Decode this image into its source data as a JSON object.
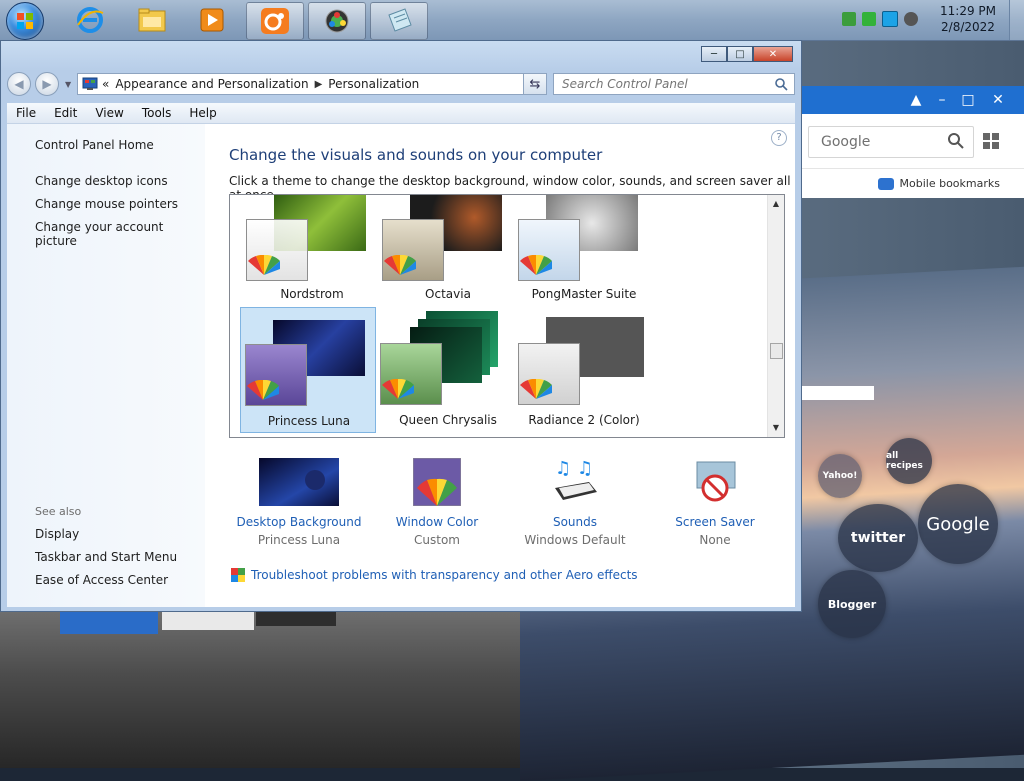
{
  "taskbar": {
    "clock_time": "11:29 PM",
    "clock_date": "2/8/2022",
    "pinned": [
      {
        "name": "internet-explorer-icon"
      },
      {
        "name": "file-explorer-icon"
      },
      {
        "name": "media-player-icon"
      },
      {
        "name": "uc-browser-icon"
      },
      {
        "name": "control-panel-icon"
      },
      {
        "name": "notepad-icon"
      }
    ]
  },
  "browser": {
    "search_text": "Google",
    "bookmarks_label": "Mobile bookmarks",
    "speed_dial": [
      "all recipes",
      "Yahoo!",
      "Google",
      "twitter",
      "Blogger"
    ]
  },
  "window": {
    "breadcrumb": [
      "Appearance and Personalization",
      "Personalization"
    ],
    "breadcrumb_prefix": "«",
    "search_placeholder": "Search Control Panel",
    "menu": [
      "File",
      "Edit",
      "View",
      "Tools",
      "Help"
    ],
    "left_links": [
      "Control Panel Home",
      "Change desktop icons",
      "Change mouse pointers",
      "Change your account picture"
    ],
    "see_also_label": "See also",
    "see_also": [
      "Display",
      "Taskbar and Start Menu",
      "Ease of Access Center"
    ],
    "title": "Change the visuals and sounds on your computer",
    "subtitle": "Click a theme to change the desktop background, window color, sounds, and screen saver all at once.",
    "themes": [
      {
        "name": "Nordstrom",
        "selected": false,
        "bg": "#5c8a2d",
        "color": "#e8e8e8"
      },
      {
        "name": "Octavia",
        "selected": false,
        "bg": "#1c1c1c",
        "color": "#c8c0ae"
      },
      {
        "name": "PongMaster Suite",
        "selected": false,
        "bg": "#9e9e9e",
        "color": "#d6e4f0"
      },
      {
        "name": "Princess Luna",
        "selected": true,
        "bg": "#10163a",
        "color": "#7a68b3"
      },
      {
        "name": "Queen Chrysalis",
        "selected": false,
        "bg": "#0e5b3b",
        "color": "#7fae74"
      },
      {
        "name": "Radiance 2 (Color)",
        "selected": false,
        "bg": "#555555",
        "color": "#e4e4e4"
      }
    ],
    "bottom_items": [
      {
        "label": "Desktop Background",
        "value": "Princess Luna"
      },
      {
        "label": "Window Color",
        "value": "Custom"
      },
      {
        "label": "Sounds",
        "value": "Windows Default"
      },
      {
        "label": "Screen Saver",
        "value": "None"
      }
    ],
    "troubleshoot": "Troubleshoot problems with transparency and other Aero effects"
  }
}
